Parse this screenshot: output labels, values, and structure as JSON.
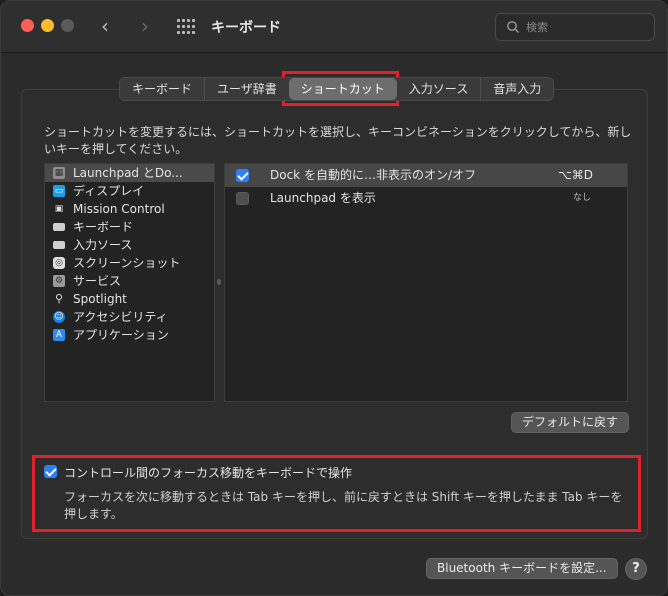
{
  "window": {
    "title": "キーボード"
  },
  "search": {
    "placeholder": "検索"
  },
  "tabs": [
    {
      "label": "キーボード"
    },
    {
      "label": "ユーザ辞書"
    },
    {
      "label": "ショートカット"
    },
    {
      "label": "入力ソース"
    },
    {
      "label": "音声入力"
    }
  ],
  "description": "ショートカットを変更するには、ショートカットを選択し、キーコンビネーションをクリックしてから、新しいキーを押してください。",
  "categories": [
    {
      "label": "Launchpad とDo...",
      "icon": "launchpad-icon"
    },
    {
      "label": "ディスプレイ",
      "icon": "display-icon"
    },
    {
      "label": "Mission Control",
      "icon": "mission-control-icon"
    },
    {
      "label": "キーボード",
      "icon": "keyboard-icon"
    },
    {
      "label": "入力ソース",
      "icon": "input-source-icon"
    },
    {
      "label": "スクリーンショット",
      "icon": "screenshot-icon"
    },
    {
      "label": "サービス",
      "icon": "services-icon"
    },
    {
      "label": "Spotlight",
      "icon": "spotlight-icon"
    },
    {
      "label": "アクセシビリティ",
      "icon": "accessibility-icon"
    },
    {
      "label": "アプリケーション",
      "icon": "app-store-icon"
    }
  ],
  "shortcuts": [
    {
      "name": "Dock を自動的に…非表示のオン/オフ",
      "key": "⌥⌘D",
      "checked": true
    },
    {
      "name": "Launchpad を表示",
      "key": "なし",
      "checked": false
    }
  ],
  "buttons": {
    "restore_defaults": "デフォルトに戻す",
    "bluetooth_setup": "Bluetooth キーボードを設定...",
    "help": "?"
  },
  "keyboard_navigation": {
    "label": "コントロール間のフォーカス移動をキーボードで操作",
    "checked": true,
    "note": "フォーカスを次に移動するときは Tab キーを押し、前に戻すときは Shift キーを押したまま Tab キーを押します。"
  },
  "colors": {
    "accent": "#2f7ff6",
    "highlight_box": "#e0202b"
  }
}
